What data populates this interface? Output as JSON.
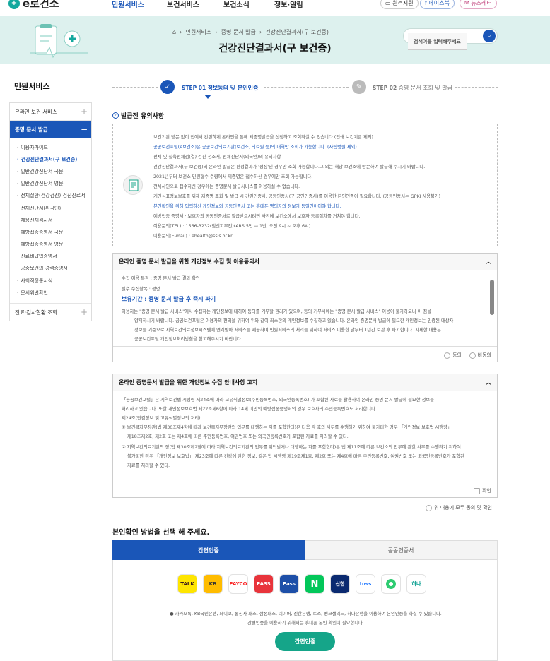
{
  "header": {
    "logo": "e로건소",
    "nav": [
      "민원서비스",
      "보건서비스",
      "보건소식",
      "정보·알림"
    ],
    "top_buttons": [
      "원격지원",
      "페이스북",
      "뉴스레터"
    ]
  },
  "hero": {
    "breadcrumb": [
      "민원서비스",
      "증명 문서 발급",
      "건강진단결과서(구 보건증)"
    ],
    "title": "건강진단결과서(구 보건증)",
    "search_placeholder": "검색어를 입력해주세요"
  },
  "sidebar": {
    "title": "민원서비스",
    "items": [
      {
        "label": "온라인 보건 서비스",
        "state": "collapsed"
      },
      {
        "label": "증명 문서 발급",
        "state": "expanded"
      }
    ],
    "sub": [
      "이용자가이드",
      "건강진단결과서(구 보건증)",
      "일반건강진단서 국문",
      "일반건강진단서 영문",
      "전체질환(건강검진) 검진진료서",
      "전체진단서(위국인)",
      "채용신체검사서",
      "예방접종증명서 국문",
      "예방접종증명서 영문",
      "진료비납입증명서",
      "공중보건의 경력증명서",
      "사회적정통서식",
      "문서위변확인"
    ],
    "bottom": "진료·검사현황 조회"
  },
  "steps": [
    {
      "num": "STEP 01",
      "label": "정보동의 및 본인인증"
    },
    {
      "num": "STEP 02",
      "label": "증명 문서 조회 및 발급"
    }
  ],
  "notice": {
    "title": "발급전 유의사항",
    "lines": [
      "보건기관 방문 없이 집에서 간편하게 온라인을 통해 제증명발급을 신청하고 조회하실 수 있습니다.(인쇄 보건기관 제외)",
      "공공보건포털(e보건소)은 공공보건의료기관(보건소, 의료원 등)의 내역만 조회가 가능합니다. (사립병원 제외)",
      "전체 및 질육전체검(결) 검진 전조서, 전체진단서(외국인)의 유의사항",
      "건강진단결과서(구 보건증)의 온라인 발급은 판정결과가 '정상'인 경우만 조회 가능합니다.그 외는 해당 보건소에 방문하여 발급해 주시기 바랍니다.",
      "2021년부터 보건소 민원협수 수령에서 제증명은 접수하신 경우에만 조회 가능합니다.",
      "전체사인으로 접수하신 경우에는 증명문서 발급서비스를 이용하실 수 없습니다.",
      "게인식표정보보호를 위해 제증명 조회 및 발급 시 간편인증서, 공동인증서(구 공인인증서)를 이용한 본인인증이 필요합니다. (공동인증서는 GPKI 사용불가)",
      "본인확인을 위해 입력하신 개인정보와 공동인증서 또는 휴대폰 명의자의 정보가 동일인이어야 합니다.",
      "예방접종 증명서 · 보호자의 공동인증서로 발급받으시려면 사전에 보건소에서 보호자 등록절차를 거쳐야 합니다.",
      "이용문의(TEL) : 1566-3232(범신지부전)(ARS 5번 → 1번, 오전 9시 ~ 오후 6시)",
      "이용문의(E-mail) : ehealth@ssis.or.kr"
    ]
  },
  "consent1": {
    "title": "온라인 증명 문서 발급을 위한 개인정보 수집 및 이용동의서",
    "lines": [
      "수집·이용 목적 : 증명 문서 발급 결과 확인",
      "필수 수집항목 : 성명",
      "보유기간 : 증명 문서 발급 후 즉시 파기",
      "이용자는 \"증명 문서 발급 서비스\"에서 수집하는 개인정보에 대하여 동의를 거부할 권리가 있으며, 동의 거부시에는 \"증명 문서 발급 서비스\" 이용이 불가하오니 이 점을",
      "양지하시기 바랍니다. 공공보건포털은 이용자의 편의을 위하여 위와 같이 최소한의 개인정보를 수집하고 있습니다. 온라인 증명문서 발급에 필요한 개인정보는 인증된 대상자",
      "정보를 기준으로 지역보건의료정보시스템에 연계받아 서비스를 제공하며 민원서비스의 처리를 위하여 서비스 이용한 날부터 1년간 보관 후 파기합니다. 자세한 내용은",
      "공공보건포털 개인정보처리방침을 참고해주시기 바랍니다."
    ],
    "agree": "동의",
    "disagree": "비동의"
  },
  "consent2": {
    "title": "온라인 증명문서 발급을 위한 개인정보 수집 안내사항 고지",
    "lines": [
      "「공공보건포털」은 지역보건법 시행령 제24조에 따라 고유식별정보(주민등록번호, 외국인등록번호) 가 포함된 자료를 활용하여 온라인 증명 문서 발급에 필요한 정보를",
      "처리하고 있습니다. 또한 개인정보보호법 제22조제6항에 따라 14세 미만의 예방접종증명서의 경우 보호자의 주민등록번호도 처리합니다.",
      "제24조(민감정보 및 고유식별정보의 처리)",
      "① 보건복지부장관(법 제30조제4항에 따라 보건복지부장관의 업무를 대행하는 자를 포함한다)은 다음 각 호의 사무를 수행하기 위하여 불가피한 경우 「개인정보 보호법 시행령」",
      "제18조제2호, 제2호 또는 제4호에 따른 주민등록번호, 여권번호 또는 외국인등록번호가 포함된 자료를 처리할 수 있다.",
      "② 지역보건의료기관의 장(법 제30조제2항에 따라 지역보건의료기관의 업무를 위탁받거나 대행하는 자를 포함한다)은 법 제11조에 따른 보건소의 업무에 관한 사무를 수행하기 위하여",
      "불가피한 경우 「개인정보 보호법」 제23조에 따른 건강에 관한 정보, 같은 법 시행령 제19조제1호, 제2호 또는 제4호에 따른 주민등록번호, 여권번호 또는 외국인등록번호가 포함된",
      "자료를 처리할 수 있다."
    ],
    "confirm": "확인"
  },
  "agree_all": "위 내용에 모두 동의 및 확인",
  "auth": {
    "title": "본인확인 방법을 선택 해 주세요.",
    "tabs": [
      "간편인증",
      "공동인증서"
    ],
    "providers": [
      "TALK",
      "KB",
      "PAYCO",
      "PASS",
      "Pass",
      "N",
      "신한",
      "toss",
      "",
      "하나"
    ],
    "note1": "카카오톡, KB국민은행, 페이코, 통신사 패스, 삼성패스, 네이버, 신한은행, 토스, 뱅크샐러드, 하나은행을 이용하여 본인인증을 하실 수 있습니다.",
    "note2": "간편인증을 이용하기 위해서는 휴대폰 본인 확인이 필요합니다.",
    "button": "간편인증"
  },
  "colors": {
    "primary": "#1a56b8",
    "green": "#15a589",
    "hero": "#ddf1ee"
  }
}
